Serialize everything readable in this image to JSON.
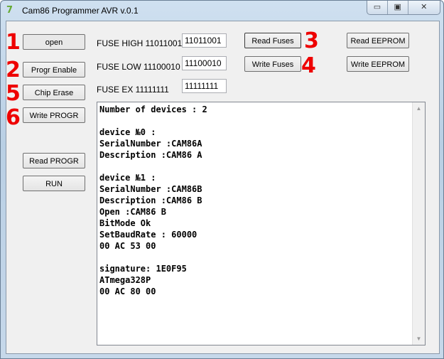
{
  "window": {
    "title": "Cam86 Programmer AVR v.0.1",
    "controls": [
      "minimize",
      "maximize",
      "close"
    ]
  },
  "buttons": {
    "open": "open",
    "progr_enable": "Progr Enable",
    "chip_erase": "Chip Erase",
    "write_progr": "Write PROGR",
    "read_progr": "Read PROGR",
    "run": "RUN",
    "read_fuses": "Read Fuses",
    "write_fuses": "Write Fuses",
    "read_eeprom": "Read EEPROM",
    "write_eeprom": "Write EEPROM"
  },
  "fuses": {
    "high_label": "FUSE HIGH 11011001",
    "high_value": "11011001",
    "low_label": "FUSE LOW 11100010",
    "low_value": "11100010",
    "ex_label": "FUSE EX 11111111",
    "ex_value": "11111111"
  },
  "annotations": {
    "n1": "1",
    "n2": "2",
    "n3": "3",
    "n4": "4",
    "n5": "5",
    "n6": "6",
    "color": "#e00000"
  },
  "log": "Number of devices : 2\n\ndevice №0 :\nSerialNumber :CAM86A\nDescription :CAM86 A\n\ndevice №1 :\nSerialNumber :CAM86B\nDescription :CAM86 B\nOpen :CAM86 B\nBitMode Ok\nSetBaudRate : 60000\n00 AC 53 00\n\nsignature: 1E0F95\nATmega328P\n00 AC 80 00"
}
